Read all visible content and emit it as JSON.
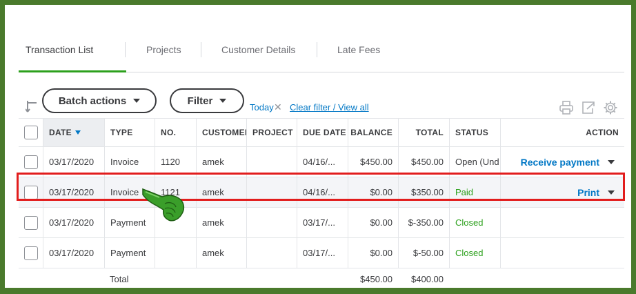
{
  "tabs": [
    {
      "label": "Transaction List",
      "active": true
    },
    {
      "label": "Projects",
      "active": false
    },
    {
      "label": "Customer Details",
      "active": false
    },
    {
      "label": "Late Fees",
      "active": false
    }
  ],
  "toolbar": {
    "batch_label": "Batch actions",
    "filter_label": "Filter",
    "filter_today": "Today",
    "clear_filter": "Clear filter / View all"
  },
  "table": {
    "headers": {
      "date": "DATE",
      "type": "TYPE",
      "no": "NO.",
      "customer": "CUSTOMER",
      "project": "PROJECT",
      "due_date": "DUE DATE",
      "balance": "BALANCE",
      "total": "TOTAL",
      "status": "STATUS",
      "action": "ACTION"
    },
    "rows": [
      {
        "date": "03/17/2020",
        "type": "Invoice",
        "no": "1120",
        "customer": "amek",
        "project": "",
        "due": "04/16/...",
        "balance": "$450.00",
        "total": "$450.00",
        "status": "Open (Und",
        "action": "Receive payment"
      },
      {
        "date": "03/17/2020",
        "type": "Invoice",
        "no": "1121",
        "customer": "amek",
        "project": "",
        "due": "04/16/...",
        "balance": "$0.00",
        "total": "$350.00",
        "status": "Paid",
        "action": "Print"
      },
      {
        "date": "03/17/2020",
        "type": "Payment",
        "no": "",
        "customer": "amek",
        "project": "",
        "due": "03/17/...",
        "balance": "$0.00",
        "total": "$-350.00",
        "status": "Closed",
        "action": ""
      },
      {
        "date": "03/17/2020",
        "type": "Payment",
        "no": "",
        "customer": "amek",
        "project": "",
        "due": "03/17/...",
        "balance": "$0.00",
        "total": "$-50.00",
        "status": "Closed",
        "action": ""
      }
    ],
    "totals": {
      "label": "Total",
      "balance": "$450.00",
      "total": "$400.00"
    }
  },
  "colors": {
    "frame_border": "#4a7a2c",
    "accent_green": "#2ca01c",
    "link_blue": "#0077c5",
    "highlight_red": "#e21d1d"
  },
  "icons": [
    "arrow-down-return-icon",
    "printer-icon",
    "export-icon",
    "gear-icon",
    "pointing-hand-icon"
  ]
}
